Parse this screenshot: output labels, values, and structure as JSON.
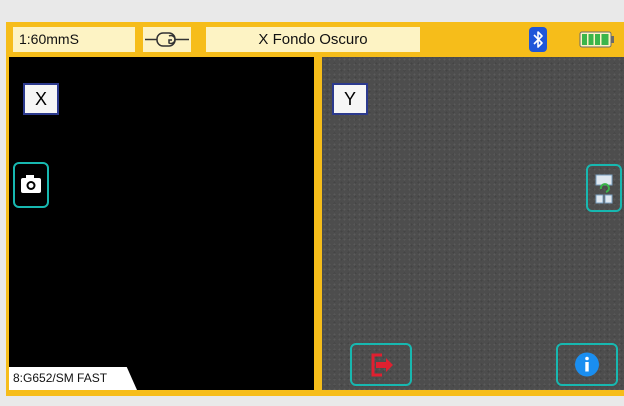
{
  "header": {
    "speed_label": "1:60mmS",
    "mode_label": "X Fondo Oscuro",
    "fiber_icon": "fiber-cleave-icon",
    "bluetooth_icon": "bluetooth-icon",
    "battery_icon": "battery-full-icon",
    "battery_level": 1.0
  },
  "left_panel": {
    "axis_label": "X",
    "camera_icon": "camera-icon",
    "fiber_type": "8:G652/SM FAST"
  },
  "right_panel": {
    "axis_label": "Y",
    "layout_icon": "view-switch-icon",
    "exit_icon": "exit-icon",
    "info_icon": "info-icon"
  },
  "colors": {
    "accent": "#f6bd1a",
    "button_border": "#17b8b0",
    "exit_red": "#e02030",
    "info_blue": "#1a8ef0",
    "bluetooth_blue": "#1f56d9",
    "battery_green": "#3bb54a"
  }
}
